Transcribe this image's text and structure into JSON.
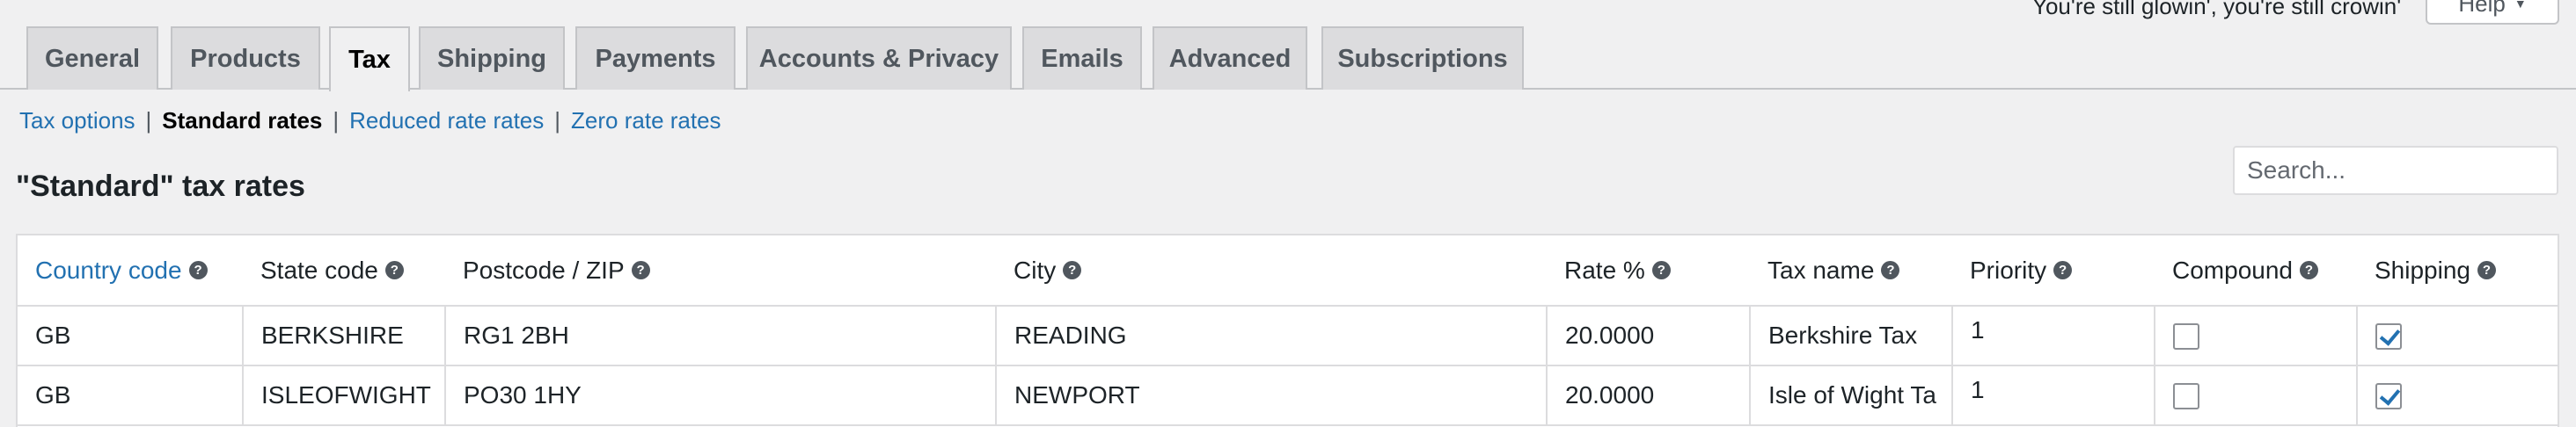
{
  "header": {
    "tagline": "You're still glowin', you're still crowin'",
    "help_label": "Help"
  },
  "tabs": [
    {
      "label": "General",
      "active": false
    },
    {
      "label": "Products",
      "active": false
    },
    {
      "label": "Tax",
      "active": true
    },
    {
      "label": "Shipping",
      "active": false
    },
    {
      "label": "Payments",
      "active": false
    },
    {
      "label": "Accounts & Privacy",
      "active": false
    },
    {
      "label": "Emails",
      "active": false
    },
    {
      "label": "Advanced",
      "active": false
    },
    {
      "label": "Subscriptions",
      "active": false
    }
  ],
  "subnav": {
    "items": [
      {
        "label": "Tax options",
        "current": false
      },
      {
        "label": "Standard rates",
        "current": true
      },
      {
        "label": "Reduced rate rates",
        "current": false
      },
      {
        "label": "Zero rate rates",
        "current": false
      }
    ],
    "separator": "|"
  },
  "page_title": "\"Standard\" tax rates",
  "search": {
    "placeholder": "Search...",
    "value": ""
  },
  "table": {
    "columns": [
      {
        "label": "Country code",
        "sortable": true
      },
      {
        "label": "State code",
        "sortable": false
      },
      {
        "label": "Postcode / ZIP",
        "sortable": false
      },
      {
        "label": "City",
        "sortable": false
      },
      {
        "label": "Rate %",
        "sortable": false
      },
      {
        "label": "Tax name",
        "sortable": false
      },
      {
        "label": "Priority",
        "sortable": false
      },
      {
        "label": "Compound",
        "sortable": false
      },
      {
        "label": "Shipping",
        "sortable": false
      }
    ],
    "help_icon": "question-circle-icon",
    "rows": [
      {
        "country": "GB",
        "state": "BERKSHIRE",
        "postcode": "RG1 2BH",
        "city": "READING",
        "rate": "20.0000",
        "name": "Berkshire Tax",
        "priority": "1",
        "compound": false,
        "shipping": true
      },
      {
        "country": "GB",
        "state": "ISLEOFWIGHT",
        "postcode": "PO30 1HY",
        "city": "NEWPORT",
        "rate": "20.0000",
        "name": "Isle of Wight Ta",
        "priority": "1",
        "compound": false,
        "shipping": true
      }
    ]
  },
  "colors": {
    "link": "#2271b1",
    "background": "#f0f0f1",
    "tab_inactive": "#dcdcde"
  }
}
